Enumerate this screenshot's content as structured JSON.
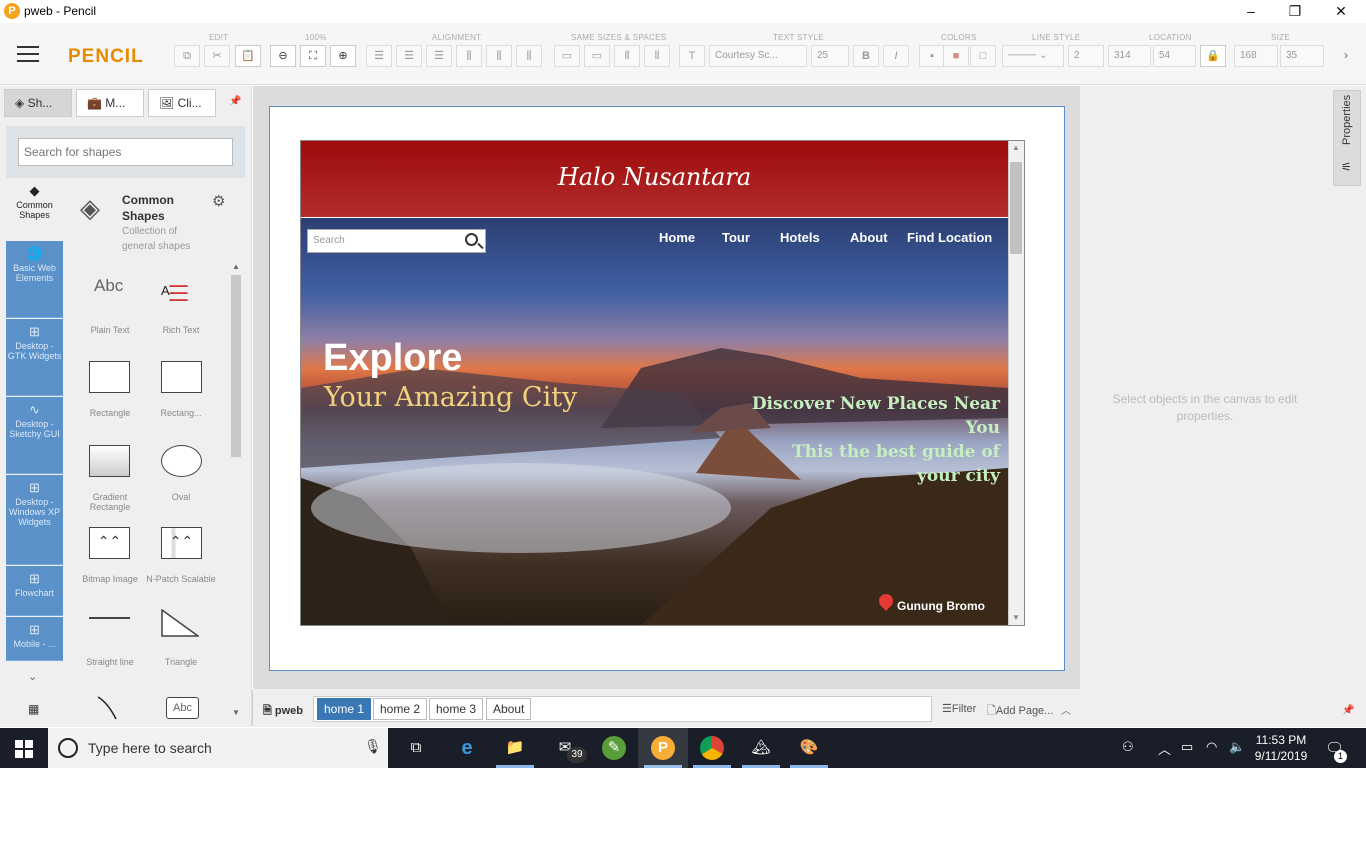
{
  "window": {
    "title": "pweb - Pencil",
    "minimize": "–",
    "restore": "❐",
    "close": "✕"
  },
  "toolbar": {
    "brand": "PENCIL",
    "groups": [
      "EDIT",
      "100%",
      "ALIGNMENT",
      "SAME SIZES & SPACES",
      "TEXT STYLE",
      "COLORS",
      "LINE STYLE",
      "LOCATION",
      "SIZE"
    ],
    "font_name": "Courtesy Sc...",
    "font_size": "25",
    "line_width": "2",
    "location_x": "314",
    "location_y": "54",
    "size_w": "168",
    "size_h": "35"
  },
  "sidebar": {
    "tabs": [
      {
        "label": "Sh..."
      },
      {
        "label": "M..."
      },
      {
        "label": "Cli..."
      }
    ],
    "search_placeholder": "Search for shapes",
    "categories": [
      {
        "label": "Common Shapes"
      },
      {
        "label": "Basic Web Elements"
      },
      {
        "label": "Desktop - GTK Widgets"
      },
      {
        "label": "Desktop - Sketchy GUI"
      },
      {
        "label": "Desktop - Windows XP Widgets"
      },
      {
        "label": "Flowchart"
      },
      {
        "label": "Mobile - ..."
      }
    ],
    "collection": {
      "title": "Common Shapes",
      "description": "Collection of general shapes"
    },
    "shapes": [
      {
        "label": "Plain Text",
        "preview": "Abc"
      },
      {
        "label": "Rich Text",
        "preview": "A"
      },
      {
        "label": "Rectangle"
      },
      {
        "label": "Rectang..."
      },
      {
        "label": "Gradient Rectangle"
      },
      {
        "label": "Oval"
      },
      {
        "label": "Bitmap Image"
      },
      {
        "label": "N-Patch Scalable"
      },
      {
        "label": "Straight line"
      },
      {
        "label": "Triangle"
      },
      {
        "label": "Abc"
      }
    ]
  },
  "mockup": {
    "site_title": "Halo Nusantara",
    "search_placeholder": "Search",
    "nav": [
      "Home",
      "Tour",
      "Hotels",
      "About",
      "Find Location"
    ],
    "hero_title": "Explore",
    "hero_subtitle": "Your Amazing City",
    "tagline_1": "Discover New Places Near You",
    "tagline_2": "This the best guide of your city",
    "location": "Gunung Bromo"
  },
  "properties": {
    "tab": "Properties",
    "hint": "Select objects in the canvas to edit properties."
  },
  "pages": {
    "document": "pweb",
    "tabs": [
      "home 1",
      "home 2",
      "home 3",
      "About"
    ],
    "active": "home 1",
    "filter": "Filter",
    "add_page": "Add Page..."
  },
  "taskbar": {
    "search_placeholder": "Type here to search",
    "mail_badge": "39",
    "time": "11:53 PM",
    "date": "9/11/2019",
    "notification_count": "1"
  },
  "colors": {
    "brand": "#e68a00",
    "header_red": "#9e0b0b",
    "accent_blue": "#3a78b5",
    "category_blue": "#5a91c9"
  }
}
